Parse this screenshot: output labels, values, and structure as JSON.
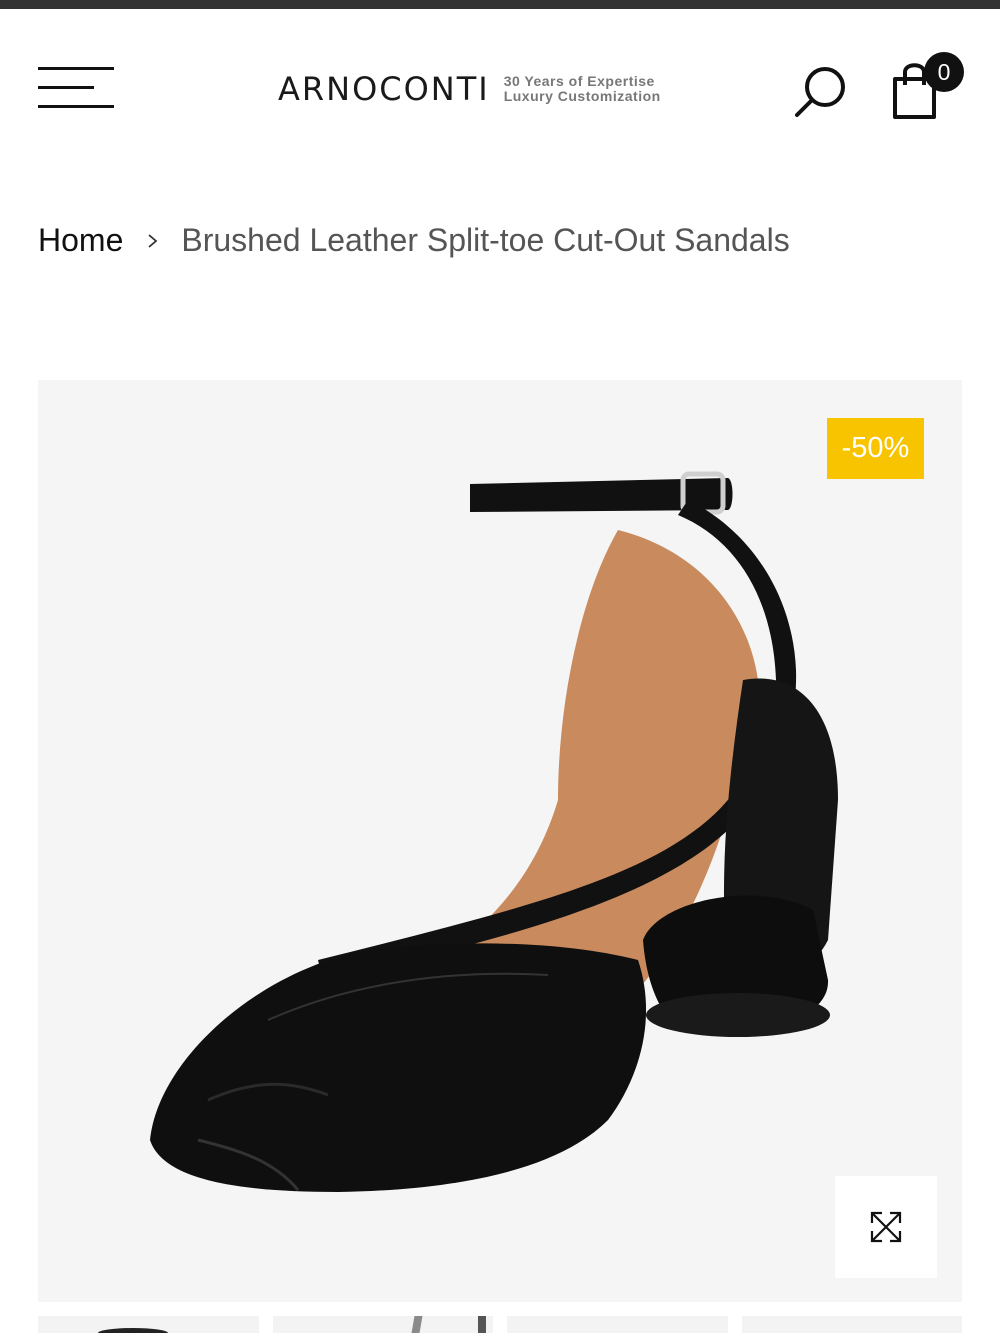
{
  "header": {
    "logo_text": "ARNOCONTI",
    "tagline_line1": "30 Years of Expertise",
    "tagline_line2": "Luxury Customization",
    "cart_count": "0"
  },
  "breadcrumb": {
    "home": "Home",
    "current": "Brushed Leather Split-toe Cut-Out Sandals"
  },
  "product_gallery": {
    "discount_badge": "-50%",
    "badge_color": "#f8c400",
    "image_subject": "black leather split-toe ankle-strap block-heel sandal",
    "zoom_icon": "expand-icon"
  },
  "thumbnails": [
    {
      "name": "thumbnail-1"
    },
    {
      "name": "thumbnail-2"
    },
    {
      "name": "thumbnail-3"
    },
    {
      "name": "thumbnail-4"
    }
  ]
}
